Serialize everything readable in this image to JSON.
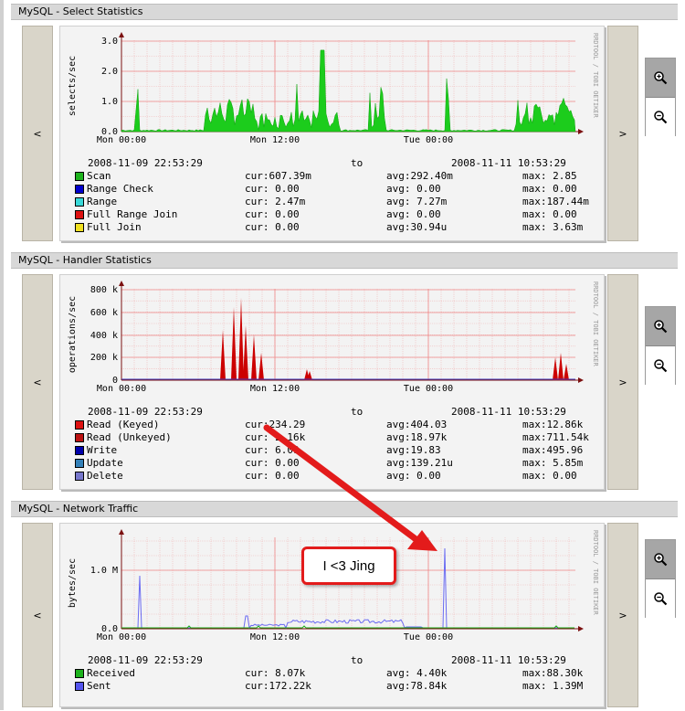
{
  "colors": {
    "grid": "#f2b8b8",
    "axis": "#7b1010",
    "area_green": "#1ccc1c",
    "area_red": "#cc0000",
    "line_blue": "#6b6bf2",
    "line_green": "#1ab11a",
    "callout": "#e31b1b"
  },
  "nav": {
    "prev": "<",
    "next": ">"
  },
  "watermark": "RRDTOOL / TOBI OETIKER",
  "time_ticks": [
    "Mon 00:00",
    "Mon 12:00",
    "Tue 00:00"
  ],
  "range": {
    "from": "2008-11-09 22:53:29",
    "to_label": "to",
    "to": "2008-11-11 10:53:29"
  },
  "sections": [
    {
      "title": "MySQL - Select Statistics",
      "ylabel": "selects/sec",
      "yticks": [
        "3.0",
        "2.0",
        "1.0",
        "0.0"
      ],
      "legend": [
        {
          "name": "Scan",
          "color": "#1db31d",
          "cur": "cur:607.39m",
          "avg": "avg:292.40m",
          "max": "max: 2.85"
        },
        {
          "name": "Range Check",
          "color": "#0000cc",
          "cur": "cur: 0.00",
          "avg": "avg: 0.00",
          "max": "max: 0.00"
        },
        {
          "name": "Range",
          "color": "#38d8d8",
          "cur": "cur: 2.47m",
          "avg": "avg: 7.27m",
          "max": "max:187.44m"
        },
        {
          "name": "Full Range Join",
          "color": "#dd1111",
          "cur": "cur: 0.00",
          "avg": "avg: 0.00",
          "max": "max: 0.00"
        },
        {
          "name": "Full Join",
          "color": "#f0e020",
          "cur": "cur: 0.00",
          "avg": "avg:30.94u",
          "max": "max: 3.63m"
        }
      ]
    },
    {
      "title": "MySQL - Handler Statistics",
      "ylabel": "operations/sec",
      "yticks": [
        "800 k",
        "600 k",
        "400 k",
        "200 k",
        "0"
      ],
      "legend": [
        {
          "name": "Read (Keyed)",
          "color": "#dd1111",
          "cur": "cur:234.29",
          "avg": "avg:404.03",
          "max": "max:12.86k"
        },
        {
          "name": "Read (Unkeyed)",
          "color": "#bb1111",
          "cur": "cur: 2.16k",
          "avg": "avg:18.97k",
          "max": "max:711.54k"
        },
        {
          "name": "Write",
          "color": "#0000aa",
          "cur": "cur: 6.09",
          "avg": "avg:19.83",
          "max": "max:495.96"
        },
        {
          "name": "Update",
          "color": "#3380b8",
          "cur": "cur: 0.00",
          "avg": "avg:139.21u",
          "max": "max: 5.85m"
        },
        {
          "name": "Delete",
          "color": "#7777cc",
          "cur": "cur: 0.00",
          "avg": "avg: 0.00",
          "max": "max: 0.00"
        }
      ]
    },
    {
      "title": "MySQL - Network Traffic",
      "ylabel": "bytes/sec",
      "yticks": [
        "1.0 M",
        "0.0"
      ],
      "legend": [
        {
          "name": "Received",
          "color": "#1db31d",
          "cur": "cur: 8.07k",
          "avg": "avg: 4.40k",
          "max": "max:88.30k"
        },
        {
          "name": "Sent",
          "color": "#5555ee",
          "cur": "cur:172.22k",
          "avg": "avg:78.84k",
          "max": "max: 1.39M"
        }
      ]
    }
  ],
  "callout": {
    "text": "I <3 Jing"
  }
}
